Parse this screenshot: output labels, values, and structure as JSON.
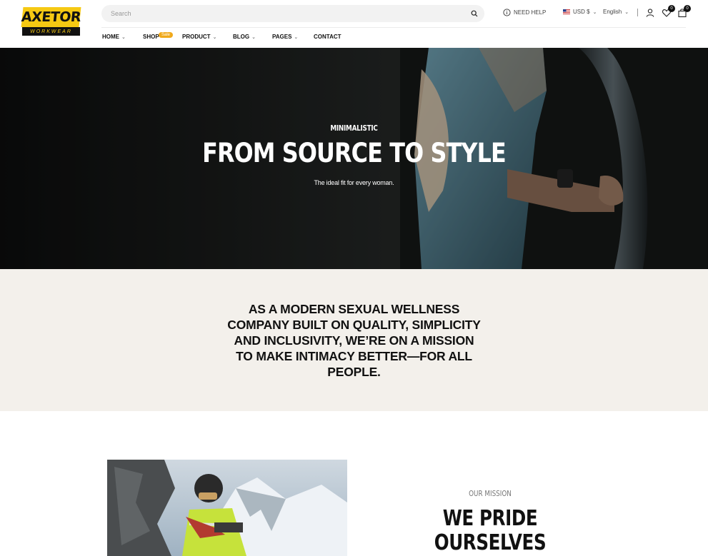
{
  "logo": {
    "name": "AXETOR",
    "tagline": "WORKWEAR"
  },
  "search": {
    "placeholder": "Search"
  },
  "header": {
    "need_help": "NEED HELP",
    "currency": "USD $",
    "language": "English",
    "wishlist_count": "0",
    "cart_count": "0"
  },
  "nav": {
    "items": [
      {
        "label": "HOME"
      },
      {
        "label": "SHOP",
        "badge": "Sale"
      },
      {
        "label": "PRODUCT"
      },
      {
        "label": "BLOG"
      },
      {
        "label": "PAGES"
      },
      {
        "label": "CONTACT"
      }
    ]
  },
  "hero": {
    "kicker": "MINIMALISTIC",
    "title": "FROM SOURCE TO STYLE",
    "subtitle": "The ideal fit for every woman."
  },
  "statement": {
    "text": "AS A MODERN SEXUAL WELLNESS COMPANY BUILT ON QUALITY, SIMPLICITY AND INCLUSIVITY, WE’RE ON A MISSION TO MAKE INTIMACY BETTER—FOR ALL PEOPLE."
  },
  "mission": {
    "kicker": "OUR MISSION",
    "title": "WE PRIDE OURSELVES"
  },
  "colors": {
    "brand_yellow": "#f6c913",
    "sale_badge": "#f0a91b",
    "statement_bg": "#f3f0eb"
  }
}
